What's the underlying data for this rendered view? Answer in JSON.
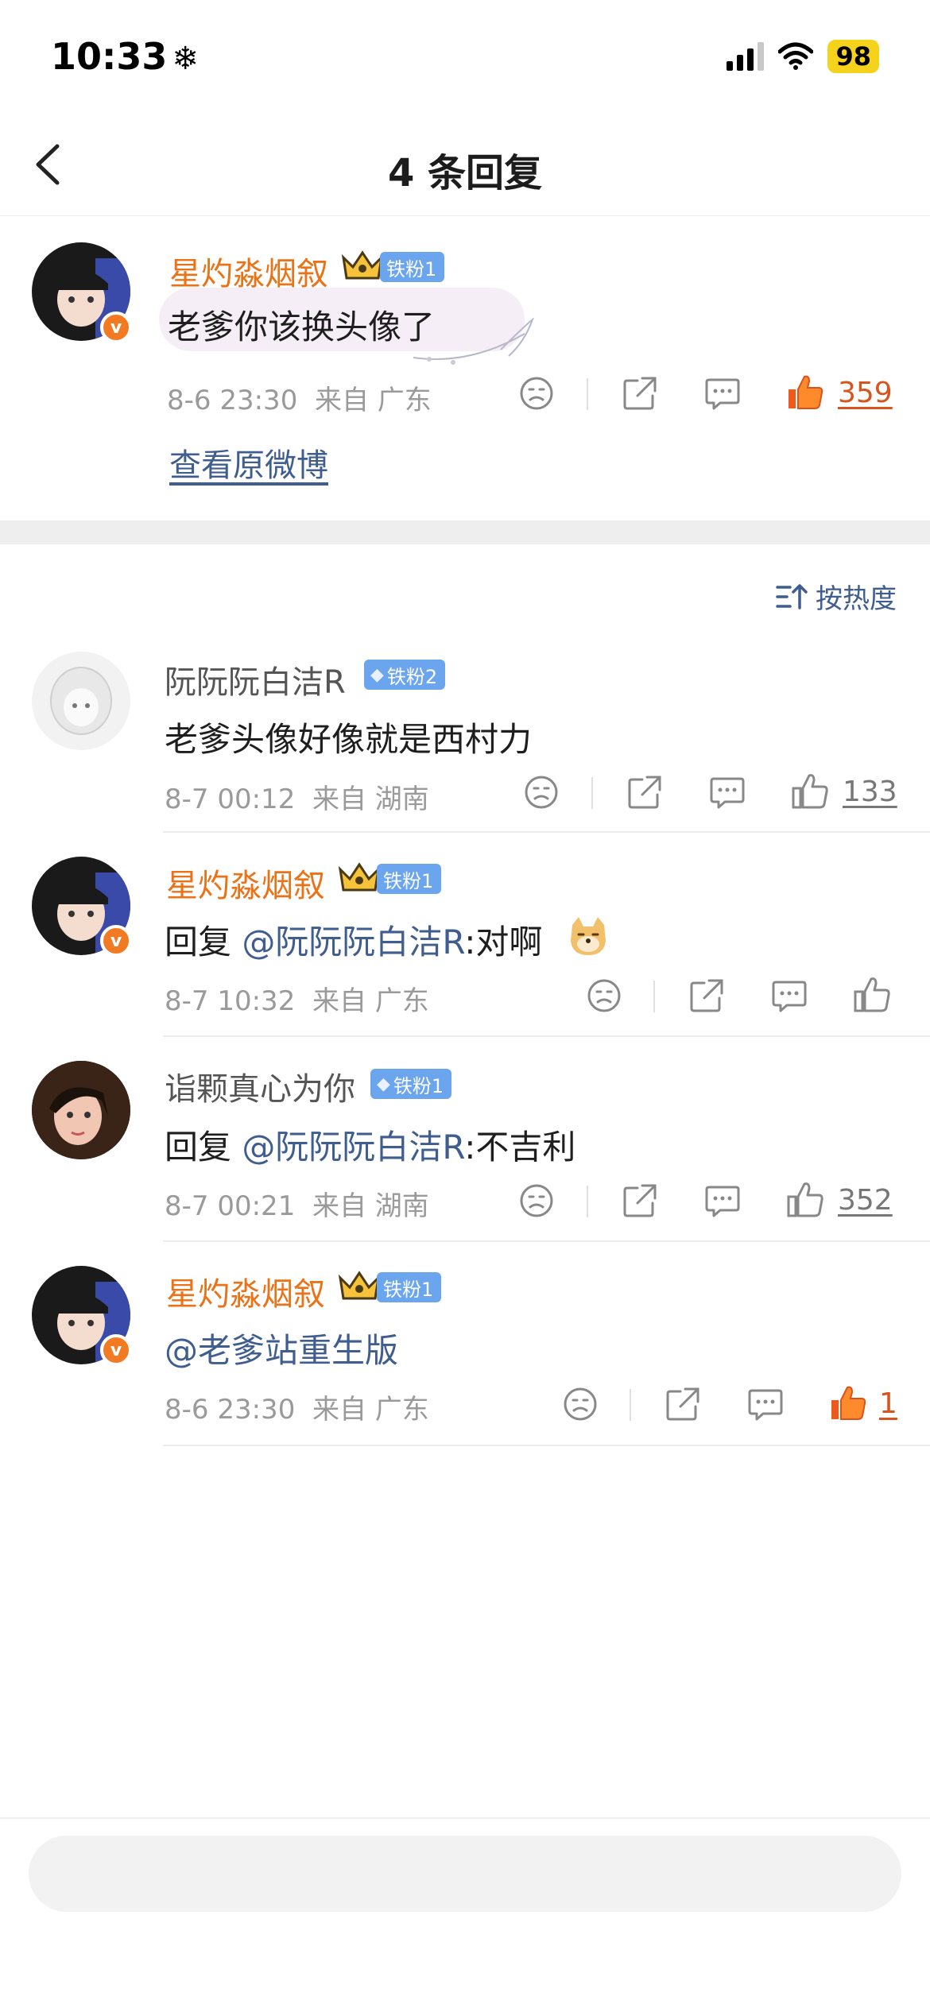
{
  "status_bar": {
    "time": "10:33",
    "extra_icon": "❄",
    "battery": "98"
  },
  "nav": {
    "title": "4 条回复"
  },
  "original_comment": {
    "username": "星灼淼烟叙",
    "fan_badge": "铁粉1",
    "text": "老爹你该换头像了",
    "time": "8-6 23:30",
    "location": "来自 广东",
    "likes": "359",
    "view_original": "查看原微博"
  },
  "sort": {
    "label": "按热度"
  },
  "replies": [
    {
      "username": "阮阮阮白洁R",
      "fan_badge": "铁粉2",
      "text": "老爹头像好像就是西村力",
      "time": "8-7 00:12",
      "location": "来自 湖南",
      "likes": "133"
    },
    {
      "username": "星灼淼烟叙",
      "fan_badge": "铁粉1",
      "reply_prefix": "回复 ",
      "mention": "@阮阮阮白洁R",
      "text": ":对啊",
      "time": "8-7 10:32",
      "location": "来自 广东",
      "likes": ""
    },
    {
      "username": "诣颗真心为你",
      "fan_badge": "铁粉1",
      "reply_prefix": "回复 ",
      "mention": "@阮阮阮白洁R",
      "text": ":不吉利",
      "time": "8-7 00:21",
      "location": "来自 湖南",
      "likes": "352"
    },
    {
      "username": "星灼淼烟叙",
      "fan_badge": "铁粉1",
      "mention": "@老爹站重生版",
      "time": "8-6 23:30",
      "location": "来自 广东",
      "likes": "1"
    }
  ],
  "colors": {
    "accent_orange": "#eb7217",
    "link_blue": "#3f5d8f",
    "like_red": "#d9531e",
    "fan_badge_blue": "#6aa5ee"
  }
}
